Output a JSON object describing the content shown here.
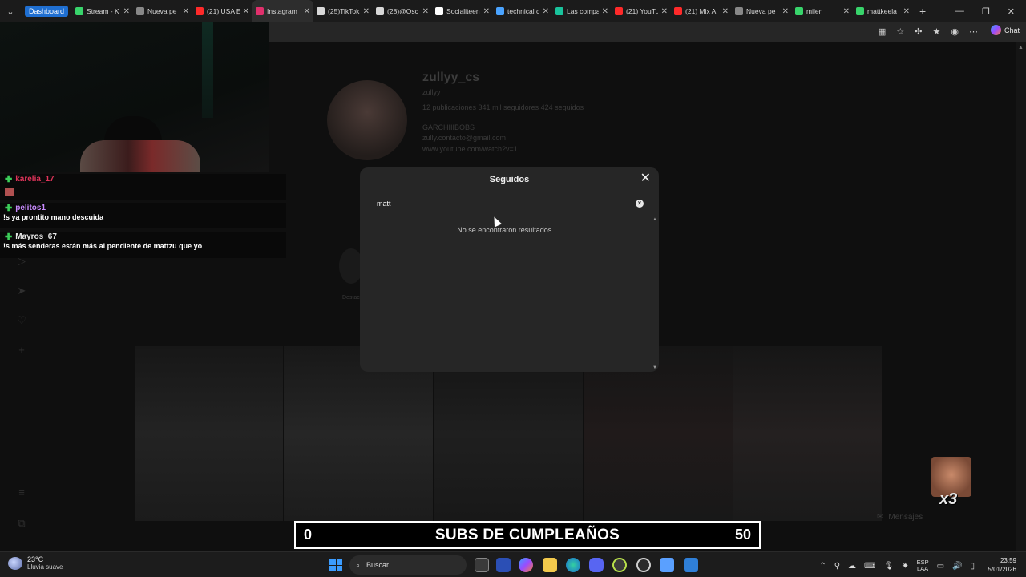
{
  "browser": {
    "tab_group": "Dashboard",
    "tabs": [
      {
        "title": "Stream - K",
        "color": "#38d46b",
        "active": false
      },
      {
        "title": "Nueva pe",
        "color": "#888888",
        "active": false
      },
      {
        "title": "(21) USA E",
        "color": "#ff2a2a",
        "active": false
      },
      {
        "title": "Instagram",
        "color": "#e1306c",
        "active": true
      },
      {
        "title": "(25)TikTok",
        "color": "#d8d8d8",
        "active": false
      },
      {
        "title": "(28)@Osc",
        "color": "#d8d8d8",
        "active": false
      },
      {
        "title": "Socialiteen",
        "color": "#ffffff",
        "active": false
      },
      {
        "title": "technical c",
        "color": "#4aa3ff",
        "active": false
      },
      {
        "title": "Las compa",
        "color": "#19c39c",
        "active": false
      },
      {
        "title": "(21) YouTu",
        "color": "#ff2a2a",
        "active": false
      },
      {
        "title": "(21) Mix A",
        "color": "#ff2a2a",
        "active": false
      },
      {
        "title": "Nueva pe",
        "color": "#888888",
        "active": false
      },
      {
        "title": "milen",
        "color": "#38d46b",
        "active": false
      },
      {
        "title": "mattkeela",
        "color": "#38d46b",
        "active": false
      }
    ],
    "chat_label": "Chat"
  },
  "profile": {
    "username": "zullyy_cs",
    "handle": "zullyy",
    "stats": "12 publicaciones   341 mil seguidores   424 seguidos",
    "bio1": "GARCHIIIBOBS",
    "bio2": "zully.contacto@gmail.com",
    "bio3": "www.youtube.com/watch?v=1...",
    "story_label": "Destac"
  },
  "modal": {
    "title": "Seguidos",
    "search_value": "matt",
    "no_results": "No se encontraron resultados."
  },
  "chat": [
    {
      "user": "karelia_17",
      "user_color": "#e0345a",
      "text": ""
    },
    {
      "user": "pelitos1",
      "user_color": "#c98bff",
      "text": "!s ya prontito mano descuida"
    },
    {
      "user": "Mayros_67",
      "user_color": "#e8e8e8",
      "text": "!s más senderas están más al pendiente de mattzu que yo"
    }
  ],
  "subs": {
    "current": "0",
    "title": "SUBS DE CUMPLEAÑOS",
    "goal": "50"
  },
  "emote": {
    "count": "x3"
  },
  "messages_label": "Mensajes",
  "taskbar": {
    "temp": "23°C",
    "weather": "Lluvia suave",
    "search": "Buscar",
    "lang1": "ESP",
    "lang2": "LAA",
    "time": "23:59",
    "date": "5/01/2026"
  }
}
